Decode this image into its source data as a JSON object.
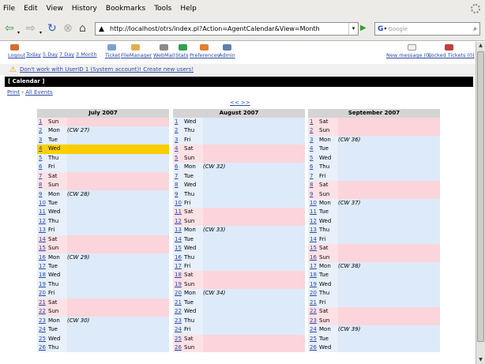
{
  "menu": [
    "File",
    "Edit",
    "View",
    "History",
    "Bookmarks",
    "Tools",
    "Help"
  ],
  "menu_underline": [
    "F",
    "E",
    "V",
    "s",
    "B",
    "T",
    "H"
  ],
  "toolbar": {
    "url": "http://localhost/otrs/index.pl?Action=AgentCalendar&View=Month",
    "search_placeholder": "Google",
    "search_engine": "G"
  },
  "otrs_nav": {
    "left": [
      "Logout",
      "Today",
      "5 Day",
      "7 Day",
      "3 Month",
      "Ticket",
      "FileManager",
      "WebMail",
      "Stats",
      "Preferences",
      "Admin"
    ],
    "right": [
      "New message (0)",
      "Locked Tickets (0)"
    ]
  },
  "notice": "Don't work with UserID 1 (System account)! Create new users!",
  "calendar_title": "[ Calendar ]",
  "print_label": "Print",
  "separator": " - ",
  "all_events_label": "All Events",
  "nav_prev_next": "<< >>",
  "colors": {
    "weekday": "#e7f0fb",
    "weekend": "#fde1e5",
    "today": "#ffcc00",
    "link": "#2b4aa0",
    "header_bar": "#000000"
  },
  "months": [
    {
      "title": "July 2007",
      "days": [
        {
          "d": "1",
          "w": "Sun",
          "cw": ""
        },
        {
          "d": "2",
          "w": "Mon",
          "cw": "(CW 27)"
        },
        {
          "d": "3",
          "w": "Tue",
          "cw": ""
        },
        {
          "d": "4",
          "w": "Wed",
          "cw": "",
          "today": true
        },
        {
          "d": "5",
          "w": "Thu",
          "cw": ""
        },
        {
          "d": "6",
          "w": "Fri",
          "cw": ""
        },
        {
          "d": "7",
          "w": "Sat",
          "cw": ""
        },
        {
          "d": "8",
          "w": "Sun",
          "cw": ""
        },
        {
          "d": "9",
          "w": "Mon",
          "cw": "(CW 28)"
        },
        {
          "d": "10",
          "w": "Tue",
          "cw": ""
        },
        {
          "d": "11",
          "w": "Wed",
          "cw": ""
        },
        {
          "d": "12",
          "w": "Thu",
          "cw": ""
        },
        {
          "d": "13",
          "w": "Fri",
          "cw": ""
        },
        {
          "d": "14",
          "w": "Sat",
          "cw": ""
        },
        {
          "d": "15",
          "w": "Sun",
          "cw": ""
        },
        {
          "d": "16",
          "w": "Mon",
          "cw": "(CW 29)"
        },
        {
          "d": "17",
          "w": "Tue",
          "cw": ""
        },
        {
          "d": "18",
          "w": "Wed",
          "cw": ""
        },
        {
          "d": "19",
          "w": "Thu",
          "cw": ""
        },
        {
          "d": "20",
          "w": "Fri",
          "cw": ""
        },
        {
          "d": "21",
          "w": "Sat",
          "cw": ""
        },
        {
          "d": "22",
          "w": "Sun",
          "cw": ""
        },
        {
          "d": "23",
          "w": "Mon",
          "cw": "(CW 30)"
        },
        {
          "d": "24",
          "w": "Tue",
          "cw": ""
        },
        {
          "d": "25",
          "w": "Wed",
          "cw": ""
        },
        {
          "d": "26",
          "w": "Thu",
          "cw": ""
        }
      ]
    },
    {
      "title": "August 2007",
      "days": [
        {
          "d": "1",
          "w": "Wed",
          "cw": ""
        },
        {
          "d": "2",
          "w": "Thu",
          "cw": ""
        },
        {
          "d": "3",
          "w": "Fri",
          "cw": ""
        },
        {
          "d": "4",
          "w": "Sat",
          "cw": ""
        },
        {
          "d": "5",
          "w": "Sun",
          "cw": ""
        },
        {
          "d": "6",
          "w": "Mon",
          "cw": "(CW 32)"
        },
        {
          "d": "7",
          "w": "Tue",
          "cw": ""
        },
        {
          "d": "8",
          "w": "Wed",
          "cw": ""
        },
        {
          "d": "9",
          "w": "Thu",
          "cw": ""
        },
        {
          "d": "10",
          "w": "Fri",
          "cw": ""
        },
        {
          "d": "11",
          "w": "Sat",
          "cw": ""
        },
        {
          "d": "12",
          "w": "Sun",
          "cw": ""
        },
        {
          "d": "13",
          "w": "Mon",
          "cw": "(CW 33)"
        },
        {
          "d": "14",
          "w": "Tue",
          "cw": ""
        },
        {
          "d": "15",
          "w": "Wed",
          "cw": ""
        },
        {
          "d": "16",
          "w": "Thu",
          "cw": ""
        },
        {
          "d": "17",
          "w": "Fri",
          "cw": ""
        },
        {
          "d": "18",
          "w": "Sat",
          "cw": ""
        },
        {
          "d": "19",
          "w": "Sun",
          "cw": ""
        },
        {
          "d": "20",
          "w": "Mon",
          "cw": "(CW 34)"
        },
        {
          "d": "21",
          "w": "Tue",
          "cw": ""
        },
        {
          "d": "22",
          "w": "Wed",
          "cw": ""
        },
        {
          "d": "23",
          "w": "Thu",
          "cw": ""
        },
        {
          "d": "24",
          "w": "Fri",
          "cw": ""
        },
        {
          "d": "25",
          "w": "Sat",
          "cw": ""
        },
        {
          "d": "26",
          "w": "Sun",
          "cw": ""
        }
      ]
    },
    {
      "title": "September 2007",
      "days": [
        {
          "d": "1",
          "w": "Sat",
          "cw": ""
        },
        {
          "d": "2",
          "w": "Sun",
          "cw": ""
        },
        {
          "d": "3",
          "w": "Mon",
          "cw": "(CW 36)"
        },
        {
          "d": "4",
          "w": "Tue",
          "cw": ""
        },
        {
          "d": "5",
          "w": "Wed",
          "cw": ""
        },
        {
          "d": "6",
          "w": "Thu",
          "cw": ""
        },
        {
          "d": "7",
          "w": "Fri",
          "cw": ""
        },
        {
          "d": "8",
          "w": "Sat",
          "cw": ""
        },
        {
          "d": "9",
          "w": "Sun",
          "cw": ""
        },
        {
          "d": "10",
          "w": "Mon",
          "cw": "(CW 37)"
        },
        {
          "d": "11",
          "w": "Tue",
          "cw": ""
        },
        {
          "d": "12",
          "w": "Wed",
          "cw": ""
        },
        {
          "d": "13",
          "w": "Thu",
          "cw": ""
        },
        {
          "d": "14",
          "w": "Fri",
          "cw": ""
        },
        {
          "d": "15",
          "w": "Sat",
          "cw": ""
        },
        {
          "d": "16",
          "w": "Sun",
          "cw": ""
        },
        {
          "d": "17",
          "w": "Mon",
          "cw": "(CW 38)"
        },
        {
          "d": "18",
          "w": "Tue",
          "cw": ""
        },
        {
          "d": "19",
          "w": "Wed",
          "cw": ""
        },
        {
          "d": "20",
          "w": "Thu",
          "cw": ""
        },
        {
          "d": "21",
          "w": "Fri",
          "cw": ""
        },
        {
          "d": "22",
          "w": "Sat",
          "cw": ""
        },
        {
          "d": "23",
          "w": "Sun",
          "cw": ""
        },
        {
          "d": "24",
          "w": "Mon",
          "cw": "(CW 39)"
        },
        {
          "d": "25",
          "w": "Tue",
          "cw": ""
        },
        {
          "d": "26",
          "w": "Wed",
          "cw": ""
        }
      ]
    }
  ]
}
